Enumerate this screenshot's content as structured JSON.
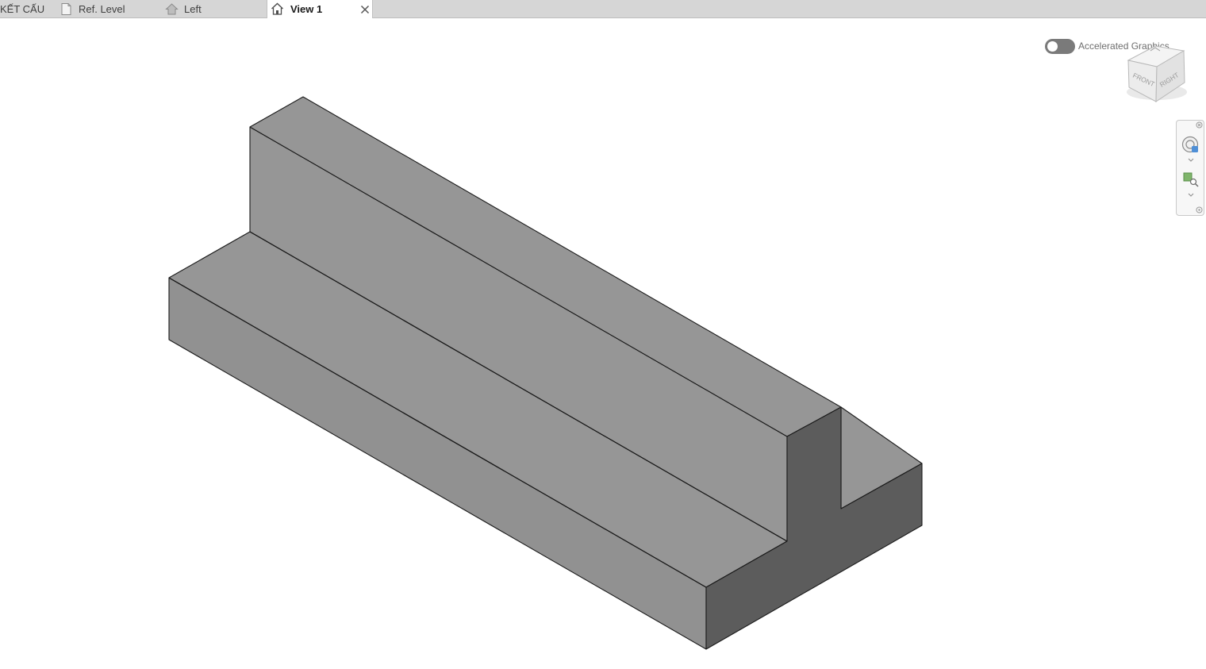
{
  "tabs": [
    {
      "label": "KẾT CẤU",
      "icon": "none",
      "active": false
    },
    {
      "label": "Ref. Level",
      "icon": "sheet-icon",
      "active": false
    },
    {
      "label": "Left",
      "icon": "elevation-icon",
      "active": false
    },
    {
      "label": "View 1",
      "icon": "house-3d-icon",
      "active": true
    }
  ],
  "accelerated_graphics": {
    "label": "Accelerated Graphics",
    "enabled": false
  },
  "viewcube": {
    "front_label": "FRONT",
    "right_label": "RIGHT"
  },
  "navbar": {
    "tools": [
      "steering-wheel-icon",
      "zoom-region-icon"
    ]
  },
  "colors": {
    "tabbar_bg": "#d6d6d6",
    "face_top": "#969696",
    "face_side": "#919191",
    "face_end": "#5c5c5c",
    "edge": "#1a1a1a"
  }
}
